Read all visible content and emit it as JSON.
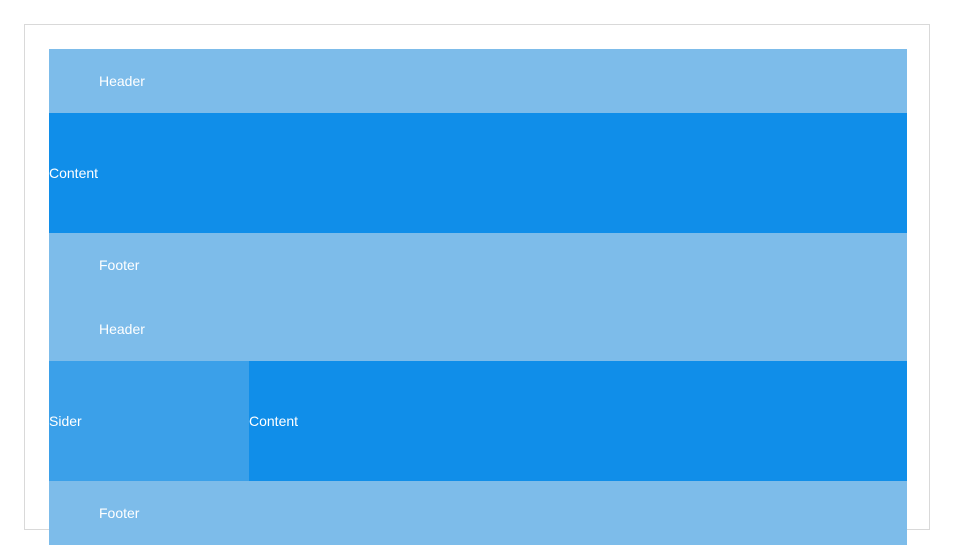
{
  "layout1": {
    "header": "Header",
    "content": "Content",
    "footer": "Footer"
  },
  "layout2": {
    "header": "Header",
    "sider": "Sider",
    "content": "Content",
    "footer": "Footer"
  },
  "colors": {
    "header_footer": "#7dbcea",
    "content": "#108ee9",
    "sider": "#3ba0e9",
    "text": "#ffffff",
    "frame_border": "#d9d9d9"
  }
}
